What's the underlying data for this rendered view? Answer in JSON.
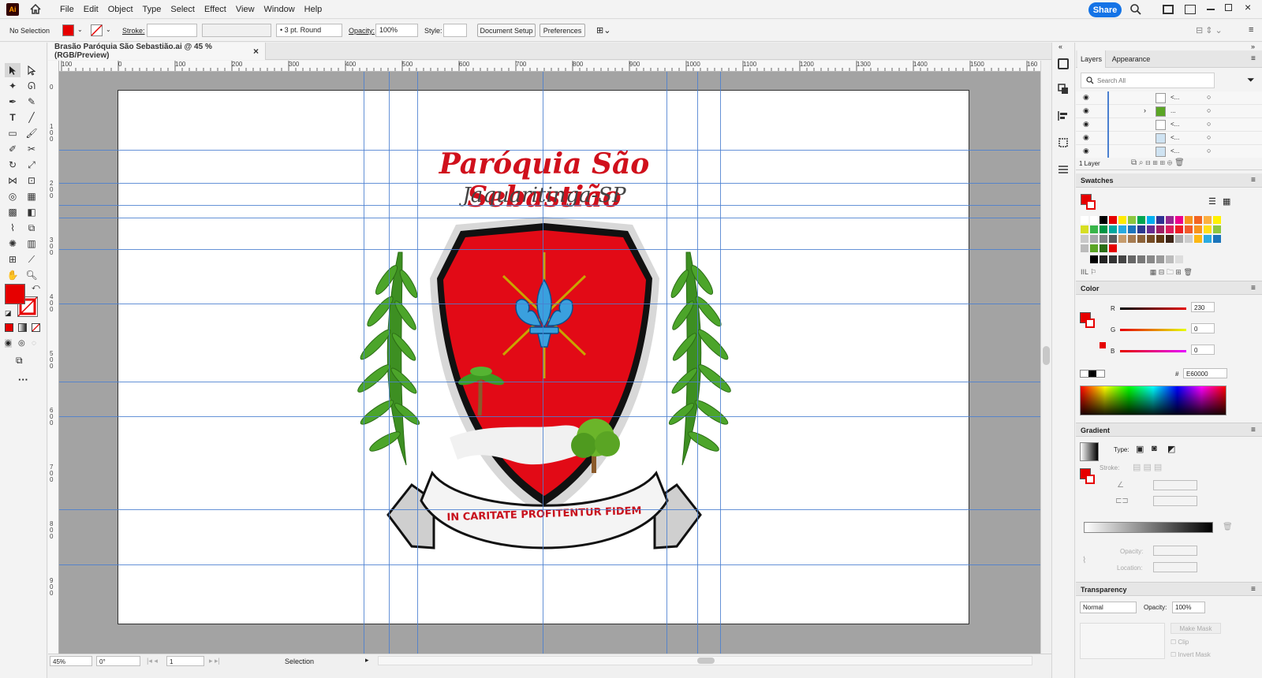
{
  "app": {
    "logo_text": "Ai"
  },
  "menu": [
    "File",
    "Edit",
    "Object",
    "Type",
    "Select",
    "Effect",
    "View",
    "Window",
    "Help"
  ],
  "share_label": "Share",
  "control": {
    "selection": "No Selection",
    "stroke_label": "Stroke:",
    "brush": "3 pt. Round",
    "opacity_label": "Opacity:",
    "opacity_value": "100%",
    "style_label": "Style:",
    "doc_setup": "Document Setup",
    "preferences": "Preferences"
  },
  "document": {
    "tab_title": "Brasão Paróquia São Sebastião.ai @ 45 % (RGB/Preview)",
    "close": "×"
  },
  "ruler": {
    "h_ticks": [
      "100",
      "0",
      "100",
      "200",
      "300",
      "400",
      "500",
      "600",
      "700",
      "800",
      "900",
      "1000",
      "1100",
      "1200",
      "1300",
      "1400",
      "1500",
      "160"
    ],
    "v_ticks": [
      "0",
      "1 0 0",
      "2 0 0",
      "3 0 0",
      "4 0 0",
      "5 0 0",
      "6 0 0",
      "7 0 0",
      "8 0 0",
      "9 0 0"
    ]
  },
  "artwork": {
    "title": "Paróquia São Sebastião",
    "subtitle": "Jaquaritinga-SP",
    "motto": "IN CARITATE PROFITENTUR FIDEM"
  },
  "status": {
    "zoom": "45%",
    "rotation": "0°",
    "artboard": "1",
    "tool": "Selection"
  },
  "layers": {
    "tab_layers": "Layers",
    "tab_appearance": "Appearance",
    "search_placeholder": "Search All",
    "rows": [
      "<...",
      "...",
      "<...",
      "<...",
      "<..."
    ],
    "count": "1 Layer"
  },
  "swatches": {
    "title": "Swatches"
  },
  "color": {
    "title": "Color",
    "r_label": "R",
    "g_label": "G",
    "b_label": "B",
    "r": "230",
    "g": "0",
    "b": "0",
    "hex_label": "#",
    "hex": "E60000"
  },
  "gradient": {
    "title": "Gradient",
    "type_label": "Type:",
    "stroke_label": "Stroke:",
    "opacity_label": "Opacity:",
    "location_label": "Location:"
  },
  "transparency": {
    "title": "Transparency",
    "mode": "Normal",
    "opacity_label": "Opacity:",
    "opacity": "100%",
    "make_mask": "Make Mask",
    "clip": "Clip",
    "invert": "Invert Mask"
  },
  "colors": {
    "accent": "#1473e6",
    "fill": "#e60000",
    "guide": "#4a7fd0"
  }
}
